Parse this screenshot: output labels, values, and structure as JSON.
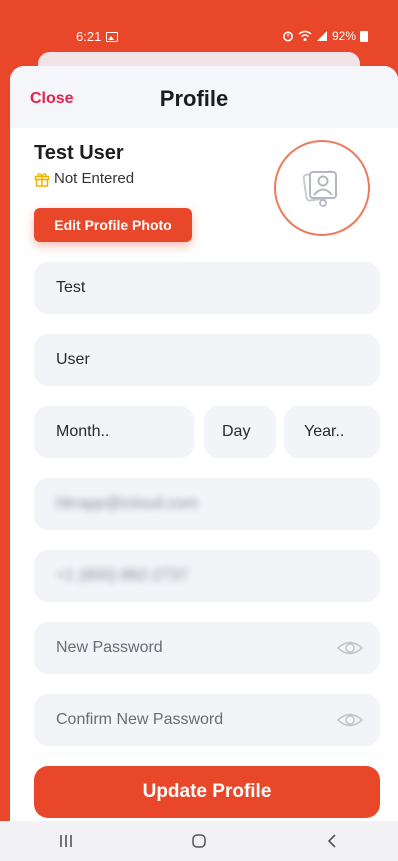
{
  "status": {
    "time": "6:21",
    "battery": "92%"
  },
  "header": {
    "close_label": "Close",
    "title": "Profile"
  },
  "user": {
    "name": "Test User",
    "birthday": "Not Entered"
  },
  "photo": {
    "edit_label": "Edit Profile Photo"
  },
  "form": {
    "first_name": "Test",
    "last_name": "User",
    "month_placeholder": "Month..",
    "day_placeholder": "Day",
    "year_placeholder": "Year..",
    "email": "hkrapp@icloud.com",
    "phone": "+1 (800) 882-2737",
    "new_password_placeholder": "New Password",
    "confirm_password_placeholder": "Confirm New Password"
  },
  "actions": {
    "update_label": "Update Profile"
  },
  "colors": {
    "accent": "#e9472a",
    "close": "#e8224a",
    "field_bg": "#f2f4f8"
  },
  "icons": {
    "status_gallery": "gallery-icon",
    "status_alarm": "alarm-icon",
    "status_wifi": "wifi-icon",
    "status_signal": "signal-icon",
    "status_battery": "battery-icon",
    "birthday": "gift-icon",
    "photo": "profile-photo-icon",
    "password_toggle": "eye-icon",
    "nav_recents": "recents-icon",
    "nav_home": "home-icon",
    "nav_back": "back-icon"
  }
}
